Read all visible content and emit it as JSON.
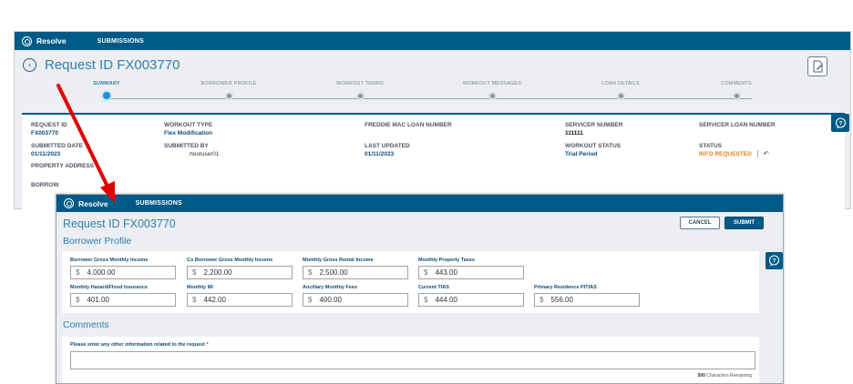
{
  "bg": {
    "brand": "Resolve",
    "nav": "SUBMISSIONS",
    "title": "Request ID FX003770",
    "steps": [
      "SUMMARY",
      "BORROWER PROFILE",
      "WORKOUT TERMS",
      "WORKOUT MESSAGES",
      "LOAN DETAILS",
      "COMMENTS"
    ],
    "details": {
      "request_id_label": "REQUEST ID",
      "request_id": "FX003770",
      "workout_type_label": "WORKOUT TYPE",
      "workout_type": "Flex Modification",
      "freddie_label": "FREDDIE MAC LOAN NUMBER",
      "servicer_number_label": "SERVICER NUMBER",
      "servicer_number": "111111",
      "servicer_loan_label": "SERVICER LOAN NUMBER",
      "submitted_date_label": "SUBMITTED DATE",
      "submitted_date": "01/11/2023",
      "submitted_by_label": "SUBMITTED BY",
      "submitted_by": "rtestuser01",
      "last_updated_label": "LAST UPDATED",
      "last_updated": "01/11/2023",
      "workout_status_label": "WORKOUT STATUS",
      "workout_status": "Trial Period",
      "status_label": "STATUS",
      "status": "INFO REQUESTED",
      "property_address_label": "PROPERTY ADDRESS",
      "borrower_label": "BORROW"
    }
  },
  "fg": {
    "brand": "Resolve",
    "nav": "SUBMISSIONS",
    "title": "Request ID FX003770",
    "subtitle": "Borrower Profile",
    "cancel": "CANCEL",
    "submit": "SUBMIT",
    "currency": "$",
    "fields": [
      {
        "label": "Borrower Gross Monthly Income",
        "value": "4,000.00"
      },
      {
        "label": "Co Borrower Gross Monthly Income",
        "value": "2,200.00"
      },
      {
        "label": "Monthly Gross Rental Income",
        "value": "2,500.00"
      },
      {
        "label": "Monthly Property Taxes",
        "value": "443.00"
      },
      {
        "label": "Monthly Hazard/Flood Insurance",
        "value": "401.00"
      },
      {
        "label": "Monthly MI",
        "value": "442.00"
      },
      {
        "label": "Ancillary Monthly Fees",
        "value": "400.00"
      },
      {
        "label": "Current TIAS",
        "value": "444.00"
      },
      {
        "label": "Primary Residence PITIAS",
        "value": "556.00"
      }
    ],
    "comments_heading": "Comments",
    "comments_label": "Please enter any other information related to the request",
    "required_mark": "*",
    "remaining_count": "500",
    "remaining_text": "Characters Remaining"
  },
  "colors": {
    "brand_bar": "#005a87",
    "title_blue": "#2f7fb1",
    "status_orange": "#e8801a",
    "arrow_red": "#e00000"
  }
}
